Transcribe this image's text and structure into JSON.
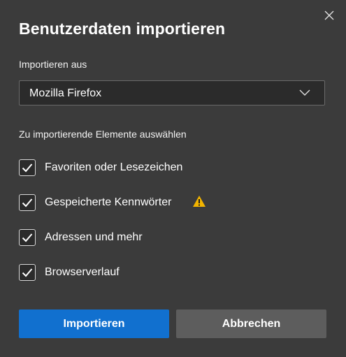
{
  "dialog": {
    "title": "Benutzerdaten importieren",
    "import_from_label": "Importieren aus",
    "source_select": {
      "value": "Mozilla Firefox"
    },
    "items_heading": "Zu importierende Elemente auswählen",
    "items": [
      {
        "label": "Favoriten oder Lesezeichen",
        "checked": true
      },
      {
        "label": "Gespeicherte Kennwörter",
        "checked": true,
        "warning": true
      },
      {
        "label": "Adressen und mehr",
        "checked": true
      },
      {
        "label": "Browserverlauf",
        "checked": true
      }
    ],
    "import_button": "Importieren",
    "cancel_button": "Abbrechen"
  },
  "icons": {
    "close": "close-icon",
    "chevron": "chevron-down-icon",
    "check": "checkmark-icon",
    "warning": "warning-icon"
  },
  "colors": {
    "background": "#3b3b3b",
    "primary_button": "#1170cf",
    "secondary_button": "#5d5d5d",
    "warning": "#f2b400"
  }
}
